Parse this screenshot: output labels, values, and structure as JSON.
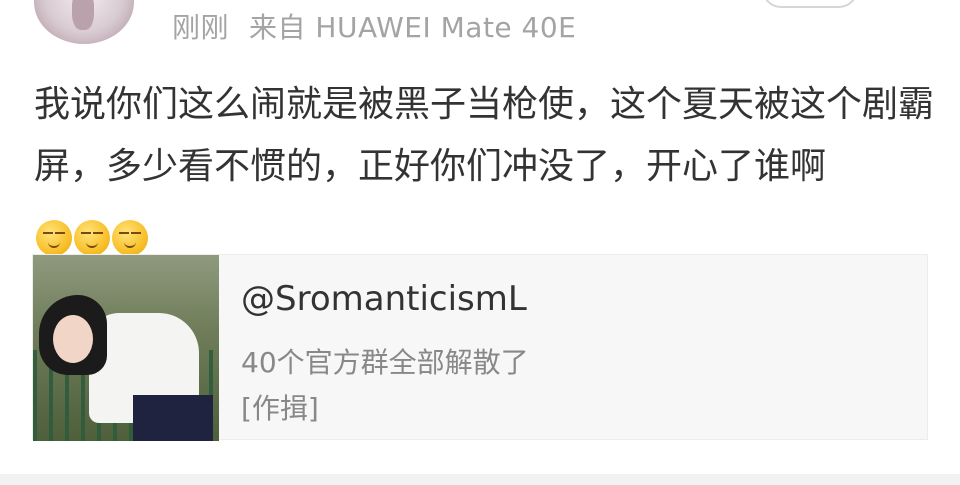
{
  "post": {
    "time": "刚刚",
    "source": "来自 HUAWEI Mate 40E",
    "text": "我说你们这么闹就是被黑子当枪使，这个夏天被这个剧霸屏，多少看不惯的，正好你们冲没了，开心了谁啊",
    "emojis": [
      "smirk-emoji",
      "smirk-emoji",
      "smirk-emoji"
    ]
  },
  "card": {
    "title": "@SromanticismL",
    "description": "40个官方群全部解散了",
    "author": "[作揖]"
  },
  "colors": {
    "meta_text": "#a4a4a4",
    "body_text": "#333333",
    "card_bg": "#f7f7f7",
    "card_secondary": "#888888"
  }
}
